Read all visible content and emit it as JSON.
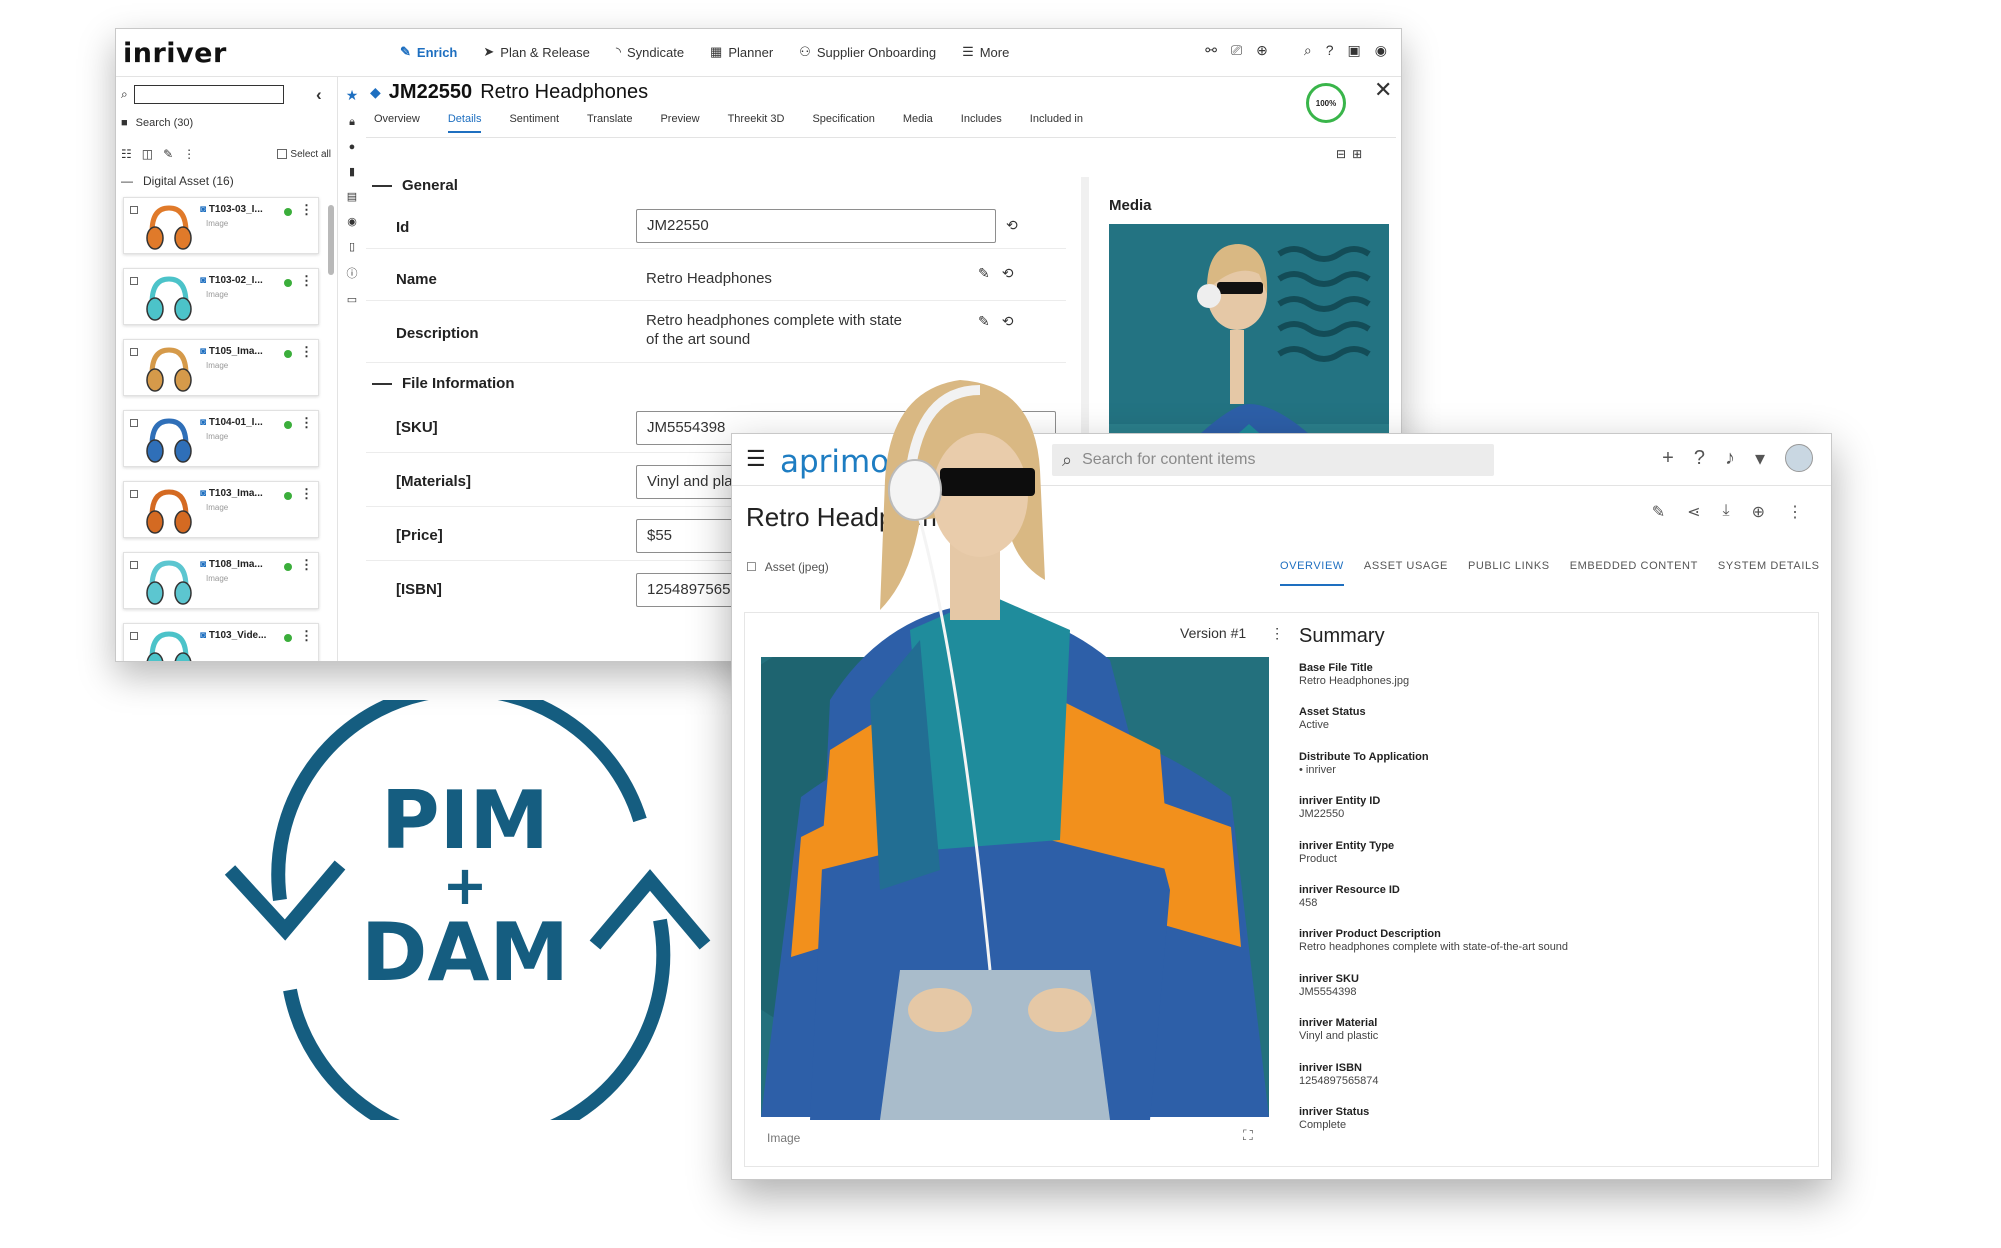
{
  "inriver": {
    "logo": "inriver",
    "nav": [
      {
        "label": "Enrich",
        "icon": "edit-icon",
        "active": true
      },
      {
        "label": "Plan & Release",
        "icon": "send-icon"
      },
      {
        "label": "Syndicate",
        "icon": "feed-icon"
      },
      {
        "label": "Planner",
        "icon": "calendar-icon"
      },
      {
        "label": "Supplier Onboarding",
        "icon": "people-icon"
      },
      {
        "label": "More",
        "icon": "menu-icon"
      }
    ],
    "search": {
      "placeholder": "",
      "count_label": "Search (30)"
    },
    "select_all": "Select all",
    "group": {
      "label": "Digital Asset (16)"
    },
    "assets": [
      {
        "name": "T103-03_I...",
        "type": "Image",
        "color": "#e07a2a"
      },
      {
        "name": "T103-02_I...",
        "type": "Image",
        "color": "#4cc3c9"
      },
      {
        "name": "T105_Ima...",
        "type": "Image",
        "color": "#d59a4a"
      },
      {
        "name": "T104-01_I...",
        "type": "Image",
        "color": "#2f6fb8"
      },
      {
        "name": "T103_Ima...",
        "type": "Image",
        "color": "#d46a22"
      },
      {
        "name": "T108_Ima...",
        "type": "Image",
        "color": "#5cc6d0"
      },
      {
        "name": "T103_Vide...",
        "type": "",
        "color": "#4cc3c9"
      }
    ],
    "entity": {
      "id": "JM22550",
      "name": "Retro Headphones"
    },
    "completeness": "100%",
    "tabs": [
      "Overview",
      "Details",
      "Sentiment",
      "Translate",
      "Preview",
      "Threekit 3D",
      "Specification",
      "Media",
      "Includes",
      "Included in"
    ],
    "active_tab": "Details",
    "sections": {
      "general": "General",
      "file_info": "File Information"
    },
    "fields": {
      "id": {
        "label": "Id",
        "value": "JM22550"
      },
      "name": {
        "label": "Name",
        "value": "Retro Headphones"
      },
      "description": {
        "label": "Description",
        "value": "Retro headphones complete with state of the art sound"
      },
      "sku": {
        "label": "[SKU]",
        "value": "JM5554398"
      },
      "materials": {
        "label": "[Materials]",
        "value": "Vinyl and plastic"
      },
      "price": {
        "label": "[Price]",
        "value": "$55"
      },
      "isbn": {
        "label": "[ISBN]",
        "value": "1254897565874"
      }
    },
    "media_title": "Media"
  },
  "aprimo": {
    "logo": "aprimo",
    "search_placeholder": "Search for content items",
    "title": "Retro Headphones",
    "asset_type": "Asset (jpeg)",
    "tabs": [
      "OVERVIEW",
      "ASSET USAGE",
      "PUBLIC LINKS",
      "EMBEDDED CONTENT",
      "SYSTEM DETAILS"
    ],
    "active_tab": "OVERVIEW",
    "version": "Version #1",
    "photo_label": "Image",
    "summary_title": "Summary",
    "summary": [
      {
        "label": "Base File Title",
        "value": "Retro Headphones.jpg"
      },
      {
        "label": "Asset Status",
        "value": "Active"
      },
      {
        "label": "Distribute To Application",
        "value": "• inriver"
      },
      {
        "label": "inriver Entity ID",
        "value": "JM22550"
      },
      {
        "label": "inriver Entity Type",
        "value": "Product"
      },
      {
        "label": "inriver Resource ID",
        "value": "458"
      },
      {
        "label": "inriver Product Description",
        "value": "Retro headphones complete with state-of-the-art sound"
      },
      {
        "label": "inriver SKU",
        "value": "JM5554398"
      },
      {
        "label": "inriver Material",
        "value": "Vinyl and plastic"
      },
      {
        "label": "inriver ISBN",
        "value": "1254897565874"
      },
      {
        "label": "inriver Status",
        "value": "Complete"
      }
    ]
  },
  "cycle": {
    "line1": "PIM",
    "line2": "+",
    "line3": "DAM",
    "color": "#155d80"
  },
  "colors": {
    "accent_blue": "#1e6fc0",
    "status_green": "#3bae3b",
    "jacket_teal": "#1f8c9c",
    "jacket_blue": "#2d5fa8",
    "jacket_orange": "#f2901c"
  }
}
